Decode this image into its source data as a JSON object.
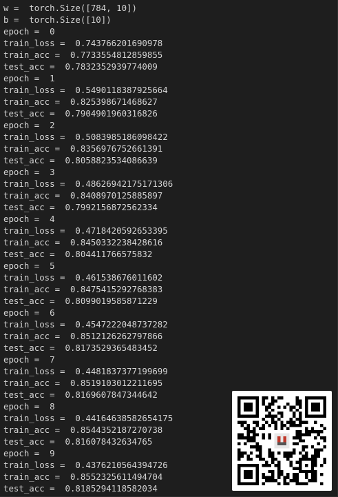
{
  "terminal": {
    "lines": [
      "w =  torch.Size([784, 10])",
      "b =  torch.Size([10])",
      "epoch =  0",
      "train_loss =  0.743766201690978",
      "train_acc =  0.7733554812859855",
      "test_acc =  0.7832352939774009",
      "epoch =  1",
      "train_loss =  0.5490118387925664",
      "train_acc =  0.825398671468627",
      "test_acc =  0.7904901960316826",
      "epoch =  2",
      "train_loss =  0.5083985186098422",
      "train_acc =  0.8356976752661391",
      "test_acc =  0.8058823534086639",
      "epoch =  3",
      "train_loss =  0.48626942175171306",
      "train_acc =  0.8408970125885897",
      "test_acc =  0.7992156872562334",
      "epoch =  4",
      "train_loss =  0.4718420592653395",
      "train_acc =  0.8450332238428616",
      "test_acc =  0.804411766575832",
      "epoch =  5",
      "train_loss =  0.461538676011602",
      "train_acc =  0.8475415292768383",
      "test_acc =  0.8099019585871229",
      "epoch =  6",
      "train_loss =  0.4547222048737282",
      "train_acc =  0.8512126262797866",
      "test_acc =  0.8173529365483452",
      "epoch =  7",
      "train_loss =  0.4481837377199699",
      "train_acc =  0.8519103012211695",
      "test_acc =  0.8169607847344642",
      "epoch =  8",
      "train_loss =  0.44164638582654175",
      "train_acc =  0.8544352187270738",
      "test_acc =  0.816078432634765",
      "epoch =  9",
      "train_loss =  0.4376210564394726",
      "train_acc =  0.8552325611494704",
      "test_acc =  0.8185294118582034"
    ]
  },
  "overlay": {
    "qr_icon": "qr-code-icon",
    "colors": {
      "dark": "#000000",
      "light": "#ffffff",
      "background": "#1e1e1e",
      "text": "#d4d4d4"
    }
  }
}
